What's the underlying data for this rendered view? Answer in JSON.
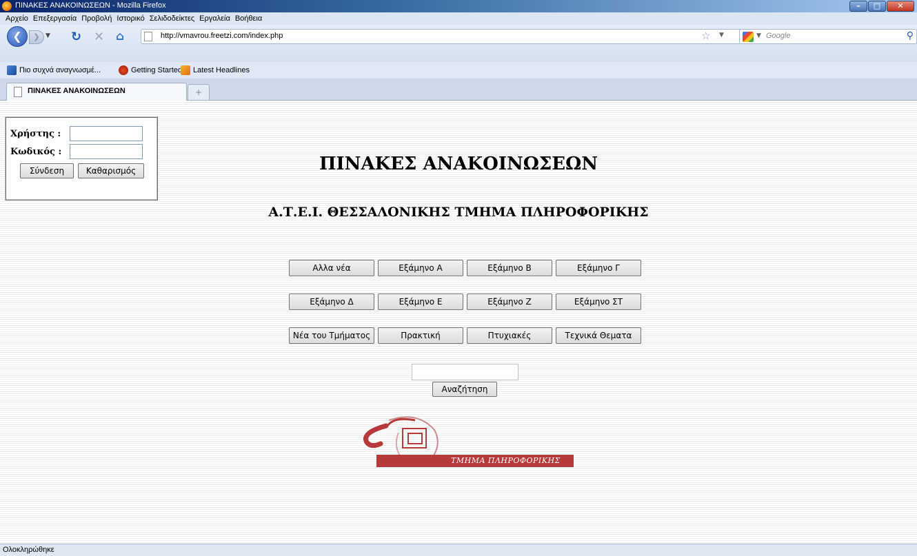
{
  "window": {
    "title": "ΠΙΝΑΚΕΣ ΑΝΑΚΟΙΝΩΣΕΩΝ - Mozilla Firefox",
    "controls": [
      "minimize",
      "maximize",
      "close"
    ]
  },
  "menu": {
    "items": [
      "Αρχείο",
      "Επεξεργασία",
      "Προβολή",
      "Ιστορικό",
      "Σελιδοδείκτες",
      "Εργαλεία",
      "Βοήθεια"
    ]
  },
  "nav": {
    "url": "http://vmavrou.freetzi.com/index.php",
    "search_placeholder": "Google",
    "icons": {
      "back": "back-arrow-icon",
      "forward": "forward-arrow-icon",
      "reload": "reload-icon",
      "stop": "stop-icon",
      "home": "home-icon",
      "bookmark_star": "star-icon",
      "search_go": "magnifier-icon"
    }
  },
  "bookmarks": {
    "items": [
      "Πιο συχνά αναγνωσμέ...",
      "Getting Started",
      "Latest Headlines"
    ]
  },
  "tabs": {
    "active": "ΠΙΝΑΚΕΣ ΑΝΑΚΟΙΝΩΣΕΩΝ",
    "new_tab": "+"
  },
  "login": {
    "user_label": "Χρήστης :",
    "password_label": "Κωδικός :",
    "user_value": "",
    "password_value": "",
    "login_button": "Σύνδεση",
    "clear_button": "Καθαρισμός"
  },
  "page": {
    "title": "ΠΙΝΑΚΕΣ ΑΝΑΚΟΙΝΩΣΕΩΝ",
    "subtitle": "Α.Τ.Ε.Ι. ΘΕΣΣΑΛΟΝΙΚΗΣ ΤΜΗΜΑ ΠΛΗΡΟΦΟΡΙΚΗΣ",
    "buttons": [
      [
        "Αλλα νέα",
        "Εξάμηνο Α",
        "Εξάμηνο Β",
        "Εξάμηνο Γ"
      ],
      [
        "Εξάμηνο Δ",
        "Εξάμηνο Ε",
        "Εξάμηνο Ζ",
        "Εξάμηνο ΣΤ"
      ],
      [
        "Νέα του Τμήματος",
        "Πρακτική",
        "Πτυχιακές",
        "Τεχνικά Θεματα"
      ]
    ],
    "search_value": "",
    "search_button": "Αναζήτηση",
    "logo_text": "ΤΜΗΜΑ ΠΛΗΡΟΦΟΡΙΚΗΣ"
  },
  "status": {
    "text": "Ολοκληρώθηκε"
  },
  "colors": {
    "titlebar": "#0a246a",
    "logo_red": "#b73a3a",
    "toolbar": "#dce6f2"
  }
}
